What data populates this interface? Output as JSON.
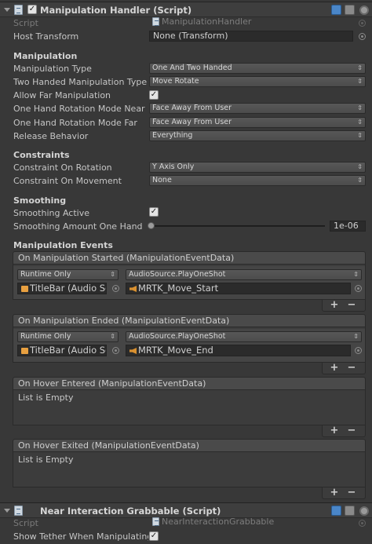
{
  "manipulation_handler": {
    "title": "Manipulation Handler (Script)",
    "enabled": true,
    "script_label": "Script",
    "script_value": "ManipulationHandler",
    "host_transform_label": "Host Transform",
    "host_transform_value": "None (Transform)",
    "sections": {
      "manipulation": "Manipulation",
      "constraints": "Constraints",
      "smoothing": "Smoothing",
      "events": "Manipulation Events"
    },
    "fields": {
      "manipulation_type_label": "Manipulation Type",
      "manipulation_type_value": "One And Two Handed",
      "two_handed_label": "Two Handed Manipulation Type",
      "two_handed_value": "Move Rotate",
      "allow_far_label": "Allow Far Manipulation",
      "allow_far_checked": true,
      "rot_near_label": "One Hand Rotation Mode Near",
      "rot_near_value": "Face Away From User",
      "rot_far_label": "One Hand Rotation Mode Far",
      "rot_far_value": "Face Away From User",
      "release_label": "Release Behavior",
      "release_value": "Everything",
      "constraint_rot_label": "Constraint On Rotation",
      "constraint_rot_value": "Y Axis Only",
      "constraint_move_label": "Constraint On Movement",
      "constraint_move_value": "None",
      "smoothing_active_label": "Smoothing Active",
      "smoothing_active_checked": true,
      "smoothing_amount_label": "Smoothing Amount One Hand",
      "smoothing_amount_value": "1e-06",
      "smoothing_amount_fraction": 0.0
    },
    "events": {
      "started": {
        "header": "On Manipulation Started (ManipulationEventData)",
        "runtime": "Runtime Only",
        "function": "AudioSource.PlayOneShot",
        "object": "TitleBar (Audio So",
        "argument": "MRTK_Move_Start"
      },
      "ended": {
        "header": "On Manipulation Ended (ManipulationEventData)",
        "runtime": "Runtime Only",
        "function": "AudioSource.PlayOneShot",
        "object": "TitleBar (Audio So",
        "argument": "MRTK_Move_End"
      },
      "hover_entered": {
        "header": "On Hover Entered (ManipulationEventData)",
        "empty": "List is Empty"
      },
      "hover_exited": {
        "header": "On Hover Exited (ManipulationEventData)",
        "empty": "List is Empty"
      },
      "plus": "+",
      "minus": "−"
    }
  },
  "near_interaction": {
    "title": "Near Interaction Grabbable (Script)",
    "script_label": "Script",
    "script_value": "NearInteractionGrabbable",
    "show_tether_label": "Show Tether When Manipulating",
    "show_tether_checked": true
  },
  "glyphs": {
    "check": "✓",
    "dropdown": "⇕"
  }
}
